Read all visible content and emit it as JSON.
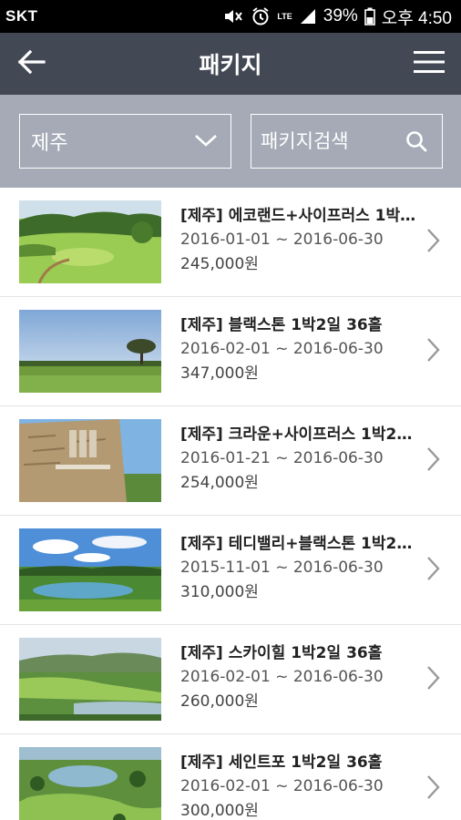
{
  "status_bar": {
    "carrier": "SKT",
    "network": "LTE",
    "battery": "39%",
    "time": "오후 4:50"
  },
  "header": {
    "title": "패키지",
    "back_icon": "arrow-left-icon",
    "menu_icon": "hamburger-menu-icon"
  },
  "filter": {
    "region": "제주",
    "search_placeholder": "패키지검색",
    "search_value": ""
  },
  "packages": [
    {
      "title": "[제주] 에코랜드+사이프러스 1박…",
      "dates": "2016-01-01 ~ 2016-06-30",
      "price": "245,000원",
      "thumb": "green fairway with trees"
    },
    {
      "title": "[제주] 블랙스톤 1박2일 36홀",
      "dates": "2016-02-01 ~ 2016-06-30",
      "price": "347,000원",
      "thumb": "fairway with tree and blue sky"
    },
    {
      "title": "[제주] 크라운+사이프러스 1박2…",
      "dates": "2016-01-21 ~ 2016-06-30",
      "price": "254,000원",
      "thumb": "stone wall sign"
    },
    {
      "title": "[제주] 테디밸리+블랙스톤 1박2…",
      "dates": "2015-11-01 ~ 2016-06-30",
      "price": "310,000원",
      "thumb": "pond with clouds"
    },
    {
      "title": "[제주] 스카이힐 1박2일 36홀",
      "dates": "2016-02-01 ~ 2016-06-30",
      "price": "260,000원",
      "thumb": "course overlooking lake"
    },
    {
      "title": "[제주] 세인트포 1박2일 36홀",
      "dates": "2016-02-01 ~ 2016-06-30",
      "price": "300,000원",
      "thumb": "aerial view with lake"
    }
  ],
  "colors": {
    "header_bg": "#424854",
    "filter_bg": "#a5aab6",
    "status_bg": "#000000"
  }
}
